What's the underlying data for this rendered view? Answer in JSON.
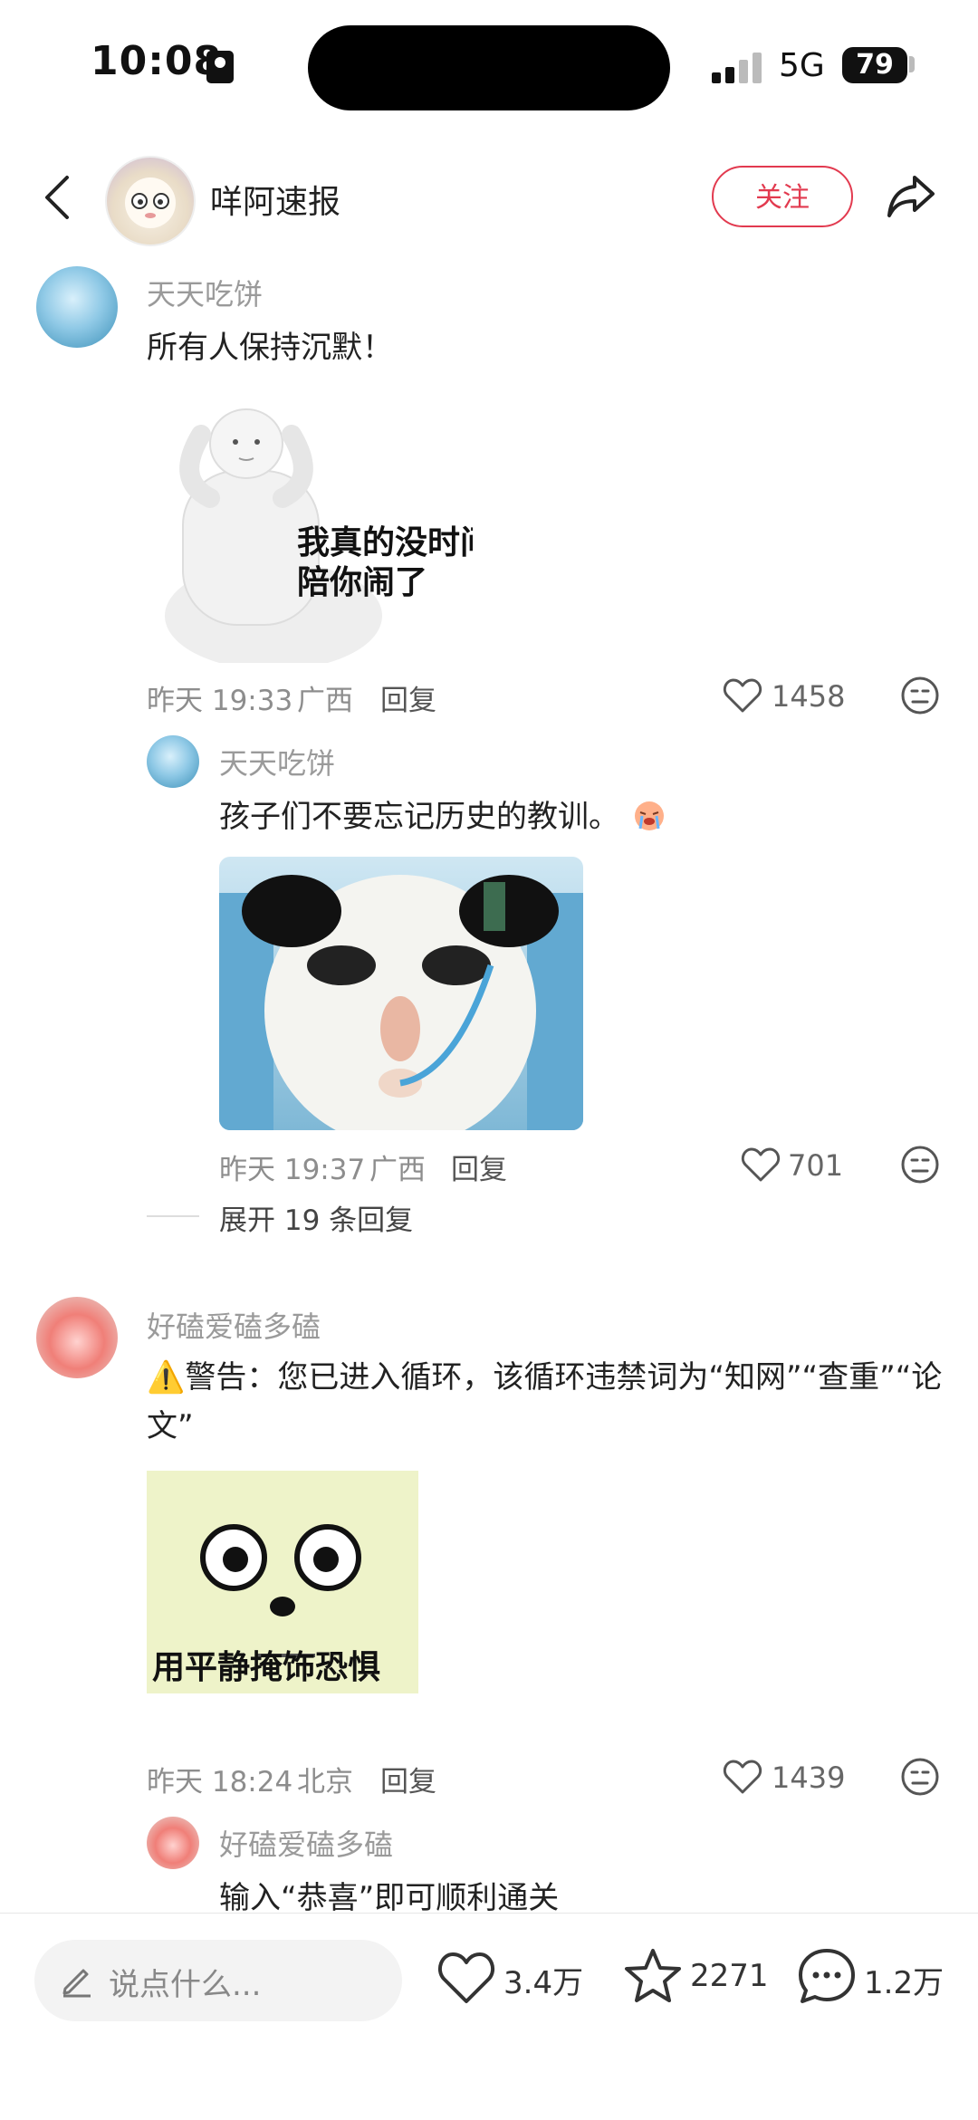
{
  "status_bar": {
    "time": "10:08",
    "network": "5G",
    "battery": "79"
  },
  "header": {
    "channel_name": "咩阿速报",
    "follow_label": "关注"
  },
  "comments": [
    {
      "user": "天天吃饼",
      "text": "所有人保持沉默！",
      "sticker_caption": "我真的没时间\n陪你闹了",
      "time": "昨天 19:33",
      "location": "广西",
      "reply_label": "回复",
      "likes": "1458",
      "replies": [
        {
          "user": "天天吃饼",
          "text": "孩子们不要忘记历史的教训。",
          "sticker_caption": "",
          "time": "昨天 19:37",
          "location": "广西",
          "reply_label": "回复",
          "likes": "701"
        }
      ],
      "expand_label": "展开 19 条回复"
    },
    {
      "user": "好磕爱磕多磕",
      "text": "⚠️警告：您已进入循环，该循环违禁词为“知网”“查重”“论文”",
      "sticker_caption": "用平静掩饰恐惧",
      "time": "昨天 18:24",
      "location": "北京",
      "reply_label": "回复",
      "likes": "1439",
      "replies": [
        {
          "user": "好磕爱磕多磕",
          "text": "输入“恭喜”即可顺利通关"
        }
      ]
    }
  ],
  "bottom_bar": {
    "input_placeholder": "说点什么...",
    "likes": "3.4万",
    "favorites": "2271",
    "comments": "1.2万"
  },
  "colors": {
    "accent": "#e23a4f"
  },
  "icons": [
    "back-icon",
    "share-icon",
    "heart-icon",
    "emoji-icon",
    "pencil-icon",
    "star-icon",
    "comment-bubble-icon"
  ]
}
